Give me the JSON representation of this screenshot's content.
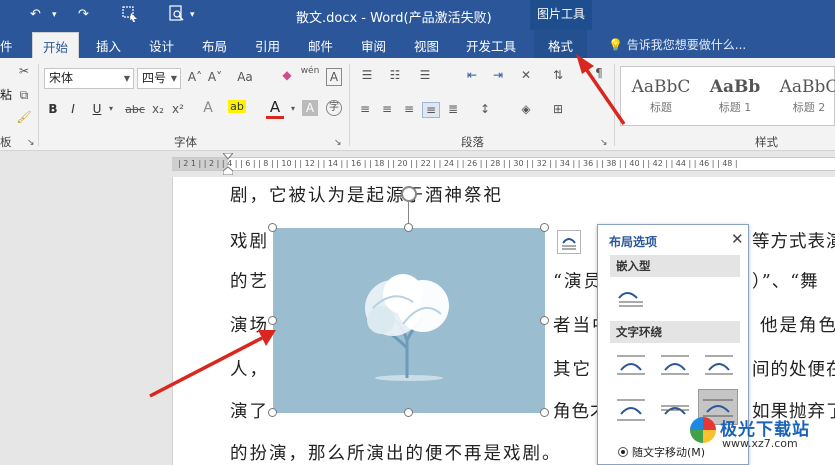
{
  "titlebar": {
    "doc_title": "散文.docx - Word(产品激活失败)",
    "context_group": "图片工具",
    "undo_glyph": "↶",
    "redo_glyph": "↷"
  },
  "tabs": {
    "file": "件",
    "home": "开始",
    "insert": "插入",
    "design": "设计",
    "layout": "布局",
    "references": "引用",
    "mailings": "邮件",
    "review": "审阅",
    "view": "视图",
    "developer": "开发工具",
    "format": "格式",
    "tell_me": "告诉我您想要做什么..."
  },
  "ribbon": {
    "font_name": "宋体",
    "font_size": "四号",
    "paste_label": "粘",
    "clipboard_group": "板",
    "font_group": "字体",
    "paragraph_group": "段落",
    "styles_group": "样式",
    "bold": "B",
    "italic": "I",
    "underline": "U",
    "strike": "abc",
    "sub": "x₂",
    "sup": "x²",
    "font_color": "A",
    "grow_font": "A˄",
    "shrink_font": "A˅",
    "change_case": "Aa",
    "pinyin": "wén",
    "char_border": "A",
    "text_effect": "A",
    "highlight": "ab",
    "char_shading": "A",
    "styles": [
      {
        "preview": "AaBbC",
        "name": "标题"
      },
      {
        "preview": "AaBb",
        "name": "标题 1"
      },
      {
        "preview": "AaBbC",
        "name": "标题 2"
      }
    ]
  },
  "ruler": {
    "marks": "| 2 1 |      | 2 |   | 4 |   | 6 |   | 8 |   | 10 |   | 12 |   | 14 |   | 16 |   | 18 |   | 20 |   | 22 |   | 24 |   | 26 |   | 28 |   | 30 |   | 32 |   | 34 |   | 36 |   | 38 |   | 40 |   | 42 |   | 44 |   | 46 |   | 48 |"
  },
  "document": {
    "lines": [
      "剧，它被认为是起源于酒神祭祀",
      "戏剧",
      "的艺",
      "演场",
      "人，",
      "演了",
      "的扮演，那么所演出的便不再是戏剧。"
    ],
    "right_fragments": [
      "等方式表演",
      "）”、“舞",
      "他是角色",
      "间的处便在",
      "如果抛弃了"
    ],
    "mid_fragments": [
      "“演员",
      "者当中",
      "其它",
      "角色才"
    ]
  },
  "layout_panel": {
    "title": "布局选项",
    "close": "✕",
    "inline_section": "嵌入型",
    "wrap_section": "文字环绕",
    "move_with_text": "随文字移动(M)"
  },
  "watermark": {
    "brand": "极光下载站",
    "url": "www.xz7.com"
  },
  "colors": {
    "brand_blue": "#2b579a",
    "image_bg": "#9bbdd0",
    "arrow_red": "#d9271f"
  }
}
